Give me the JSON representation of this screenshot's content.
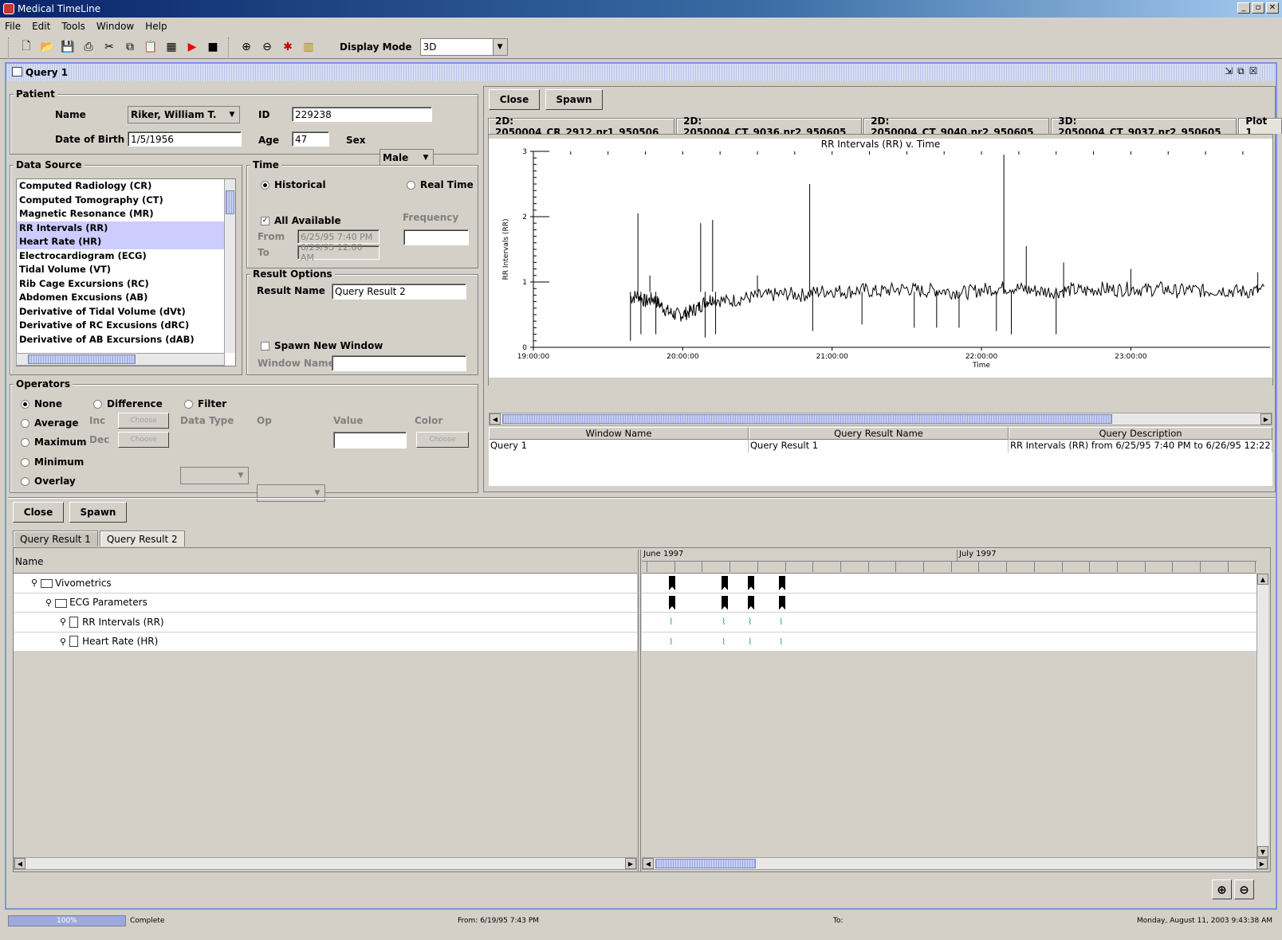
{
  "app": {
    "title": "Medical TimeLine"
  },
  "menu": [
    "File",
    "Edit",
    "Tools",
    "Window",
    "Help"
  ],
  "toolbar": {
    "display_mode_label": "Display Mode",
    "display_mode_value": "3D"
  },
  "query_window": {
    "title": "Query 1"
  },
  "patient": {
    "group_label": "Patient",
    "name_label": "Name",
    "name_value": "Riker, William T.",
    "id_label": "ID",
    "id_value": "229238",
    "dob_label": "Date of Birth",
    "dob_value": "1/5/1956",
    "age_label": "Age",
    "age_value": "47",
    "sex_label": "Sex",
    "sex_value": "Male"
  },
  "data_source": {
    "group_label": "Data Source",
    "items": [
      {
        "label": "Computed Radiology (CR)",
        "selected": false
      },
      {
        "label": "Computed Tomography (CT)",
        "selected": false
      },
      {
        "label": "Magnetic Resonance (MR)",
        "selected": false
      },
      {
        "label": "RR Intervals (RR)",
        "selected": true
      },
      {
        "label": "Heart Rate (HR)",
        "selected": true
      },
      {
        "label": "Electrocardiogram (ECG)",
        "selected": false
      },
      {
        "label": "Tidal Volume (VT)",
        "selected": false
      },
      {
        "label": "Rib Cage Excursions (RC)",
        "selected": false
      },
      {
        "label": "Abdomen Excusions (AB)",
        "selected": false
      },
      {
        "label": "Derivative of Tidal Volume (dVt)",
        "selected": false
      },
      {
        "label": "Derivative of RC Excusions (dRC)",
        "selected": false
      },
      {
        "label": "Derivative of AB Excursions (dAB)",
        "selected": false
      }
    ]
  },
  "time": {
    "group_label": "Time",
    "historical": "Historical",
    "real_time": "Real Time",
    "all_available": "All Available",
    "frequency_label": "Frequency",
    "from_label": "From",
    "from_value": "6/25/95 7:40 PM",
    "to_label": "To",
    "to_value": "6/29/95 12:00 AM"
  },
  "result_options": {
    "group_label": "Result Options",
    "result_name_label": "Result Name",
    "result_name_value": "Query Result 2",
    "spawn_new_window": "Spawn New Window",
    "window_name_label": "Window Name"
  },
  "operators": {
    "group_label": "Operators",
    "none": "None",
    "difference": "Difference",
    "filter": "Filter",
    "average": "Average",
    "maximum": "Maximum",
    "minimum": "Minimum",
    "overlay": "Overlay",
    "inc": "Inc",
    "dec": "Dec",
    "choose": "Choose",
    "data_type": "Data Type",
    "op": "Op",
    "value": "Value",
    "color": "Color"
  },
  "right_panel": {
    "close": "Close",
    "spawn": "Spawn",
    "tabs": [
      "2D: 2050004_CR_2912.nr1_950506",
      "2D: 2050004_CT_9036.nr2_950605",
      "2D: 2050004_CT_9040.nr2_950605",
      "3D: 2050004_CT_9037.nr2_950605",
      "Plot 1"
    ],
    "active_tab": 4
  },
  "chart_data": {
    "type": "line",
    "title": "RR Intervals (RR) v. Time",
    "xlabel": "Time",
    "ylabel": "RR Intervals (RR)",
    "ylim": [
      0,
      3
    ],
    "yticks": [
      "0",
      "1",
      "2",
      "3"
    ],
    "xticks": [
      "19:00:00",
      "20:00:00",
      "21:00:00",
      "22:00:00",
      "23:00:00"
    ],
    "xlim_hours": [
      19.0,
      23.9
    ],
    "series": [
      {
        "points": [
          [
            19.65,
            0.75
          ],
          [
            19.7,
            0.8
          ],
          [
            19.75,
            0.7
          ],
          [
            19.8,
            0.75
          ],
          [
            19.85,
            0.65
          ],
          [
            19.9,
            0.55
          ],
          [
            19.95,
            0.5
          ],
          [
            20.0,
            0.5
          ],
          [
            20.05,
            0.55
          ],
          [
            20.1,
            0.6
          ],
          [
            20.15,
            0.7
          ],
          [
            20.2,
            0.75
          ],
          [
            20.3,
            0.7
          ],
          [
            20.4,
            0.75
          ],
          [
            20.5,
            0.78
          ],
          [
            20.6,
            0.8
          ],
          [
            20.7,
            0.82
          ],
          [
            20.8,
            0.8
          ],
          [
            20.9,
            0.85
          ],
          [
            21.0,
            0.87
          ],
          [
            21.1,
            0.85
          ],
          [
            21.2,
            0.88
          ],
          [
            21.3,
            0.85
          ],
          [
            21.4,
            0.88
          ],
          [
            21.5,
            0.9
          ],
          [
            21.6,
            0.86
          ],
          [
            21.7,
            0.88
          ],
          [
            21.8,
            0.85
          ],
          [
            21.9,
            0.84
          ],
          [
            22.0,
            0.88
          ],
          [
            22.1,
            0.9
          ],
          [
            22.2,
            0.92
          ],
          [
            22.3,
            0.88
          ],
          [
            22.4,
            0.86
          ],
          [
            22.5,
            0.85
          ],
          [
            22.6,
            0.88
          ],
          [
            22.7,
            0.86
          ],
          [
            22.8,
            0.9
          ],
          [
            22.9,
            0.88
          ],
          [
            23.0,
            0.9
          ],
          [
            23.1,
            0.88
          ],
          [
            23.2,
            0.9
          ],
          [
            23.3,
            0.86
          ],
          [
            23.4,
            0.88
          ],
          [
            23.5,
            0.86
          ],
          [
            23.6,
            0.88
          ],
          [
            23.7,
            0.86
          ],
          [
            23.8,
            0.85
          ],
          [
            23.9,
            0.88
          ]
        ],
        "spikes": [
          [
            19.65,
            0.1
          ],
          [
            19.7,
            2.05
          ],
          [
            19.72,
            0.2
          ],
          [
            19.78,
            1.1
          ],
          [
            19.82,
            0.2
          ],
          [
            20.12,
            1.9
          ],
          [
            20.15,
            0.15
          ],
          [
            20.2,
            1.95
          ],
          [
            20.22,
            0.2
          ],
          [
            20.5,
            1.1
          ],
          [
            20.85,
            2.5
          ],
          [
            20.87,
            0.25
          ],
          [
            21.2,
            0.35
          ],
          [
            21.55,
            0.3
          ],
          [
            21.7,
            0.3
          ],
          [
            21.85,
            0.3
          ],
          [
            22.1,
            0.25
          ],
          [
            22.15,
            2.95
          ],
          [
            22.2,
            0.2
          ],
          [
            22.3,
            1.55
          ],
          [
            22.5,
            0.2
          ],
          [
            22.55,
            1.3
          ],
          [
            23.0,
            1.2
          ],
          [
            23.85,
            1.15
          ]
        ]
      }
    ]
  },
  "results_table": {
    "headers": [
      "Window Name",
      "Query Result Name",
      "Query Description"
    ],
    "rows": [
      [
        "Query 1",
        "Query Result 1",
        "RR Intervals (RR) from 6/25/95 7:40 PM to 6/26/95 12:22 ..."
      ]
    ]
  },
  "bottom_panel": {
    "close": "Close",
    "spawn": "Spawn",
    "tabs": [
      "Query Result 1",
      "Query Result 2"
    ],
    "name_header": "Name",
    "tree": [
      {
        "label": "Vivometrics",
        "level": 0,
        "kind": "folder"
      },
      {
        "label": "ECG Parameters",
        "level": 1,
        "kind": "folder"
      },
      {
        "label": "RR Intervals (RR)",
        "level": 2,
        "kind": "doc"
      },
      {
        "label": "Heart Rate (HR)",
        "level": 2,
        "kind": "doc"
      }
    ],
    "months": [
      "June 1997",
      "July 1997"
    ]
  },
  "status": {
    "progress": "100%",
    "progress_value": 1.0,
    "state": "Complete",
    "from": "From:  6/19/95 7:43 PM",
    "to": "To:",
    "datetime": "Monday, August 11, 2003 9:43:38 AM"
  }
}
